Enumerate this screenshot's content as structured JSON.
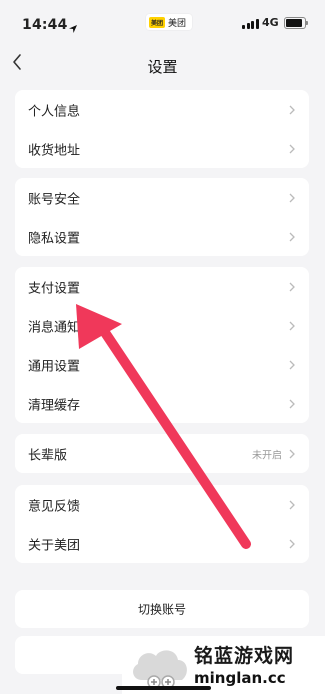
{
  "status_bar": {
    "time": "14:44",
    "app_label": "美团",
    "app_logo_text": "美团",
    "network": "4G"
  },
  "nav": {
    "title": "设置"
  },
  "groups": [
    {
      "items": [
        {
          "label": "个人信息"
        },
        {
          "label": "收货地址"
        }
      ]
    },
    {
      "items": [
        {
          "label": "账号安全"
        },
        {
          "label": "隐私设置"
        }
      ]
    },
    {
      "items": [
        {
          "label": "支付设置"
        },
        {
          "label": "消息通知"
        },
        {
          "label": "通用设置"
        },
        {
          "label": "清理缓存"
        }
      ]
    },
    {
      "items": [
        {
          "label": "长辈版",
          "value": "未开启"
        }
      ]
    },
    {
      "items": [
        {
          "label": "意见反馈"
        },
        {
          "label": "关于美团"
        }
      ]
    }
  ],
  "switch_account": {
    "label": "切换账号"
  },
  "watermark": {
    "line1": "铭蓝游戏网",
    "line2": "minglan.cc"
  },
  "colors": {
    "background": "#f4f4f6",
    "card": "#ffffff",
    "annotation_arrow": "#f0385a",
    "chevron": "#bbbbbb",
    "secondary_text": "#999999"
  },
  "annotation": {
    "type": "arrow",
    "points_to": "支付设置"
  }
}
